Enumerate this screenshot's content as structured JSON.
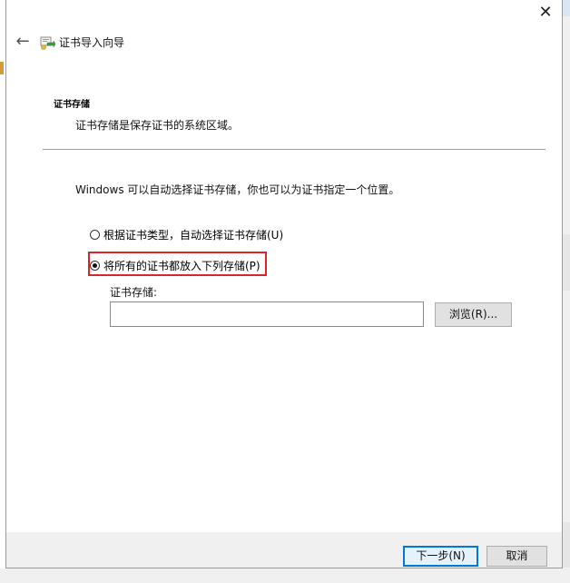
{
  "window": {
    "close_glyph": "✕",
    "back_glyph": "←",
    "title": "证书导入向导"
  },
  "section": {
    "title": "证书存储",
    "description": "证书存储是保存证书的系统区域。"
  },
  "intro_text": "Windows 可以自动选择证书存储，你也可以为证书指定一个位置。",
  "options": [
    {
      "label": "根据证书类型，自动选择证书存储(U)",
      "checked": false
    },
    {
      "label": "将所有的证书都放入下列存储(P)",
      "checked": true
    }
  ],
  "store": {
    "label": "证书存储:",
    "value": "",
    "browse_label": "浏览(R)..."
  },
  "footer": {
    "next_label": "下一步(N)",
    "cancel_label": "取消"
  },
  "colors": {
    "highlight": "#d9262c",
    "default_button_border": "#0078d7"
  }
}
